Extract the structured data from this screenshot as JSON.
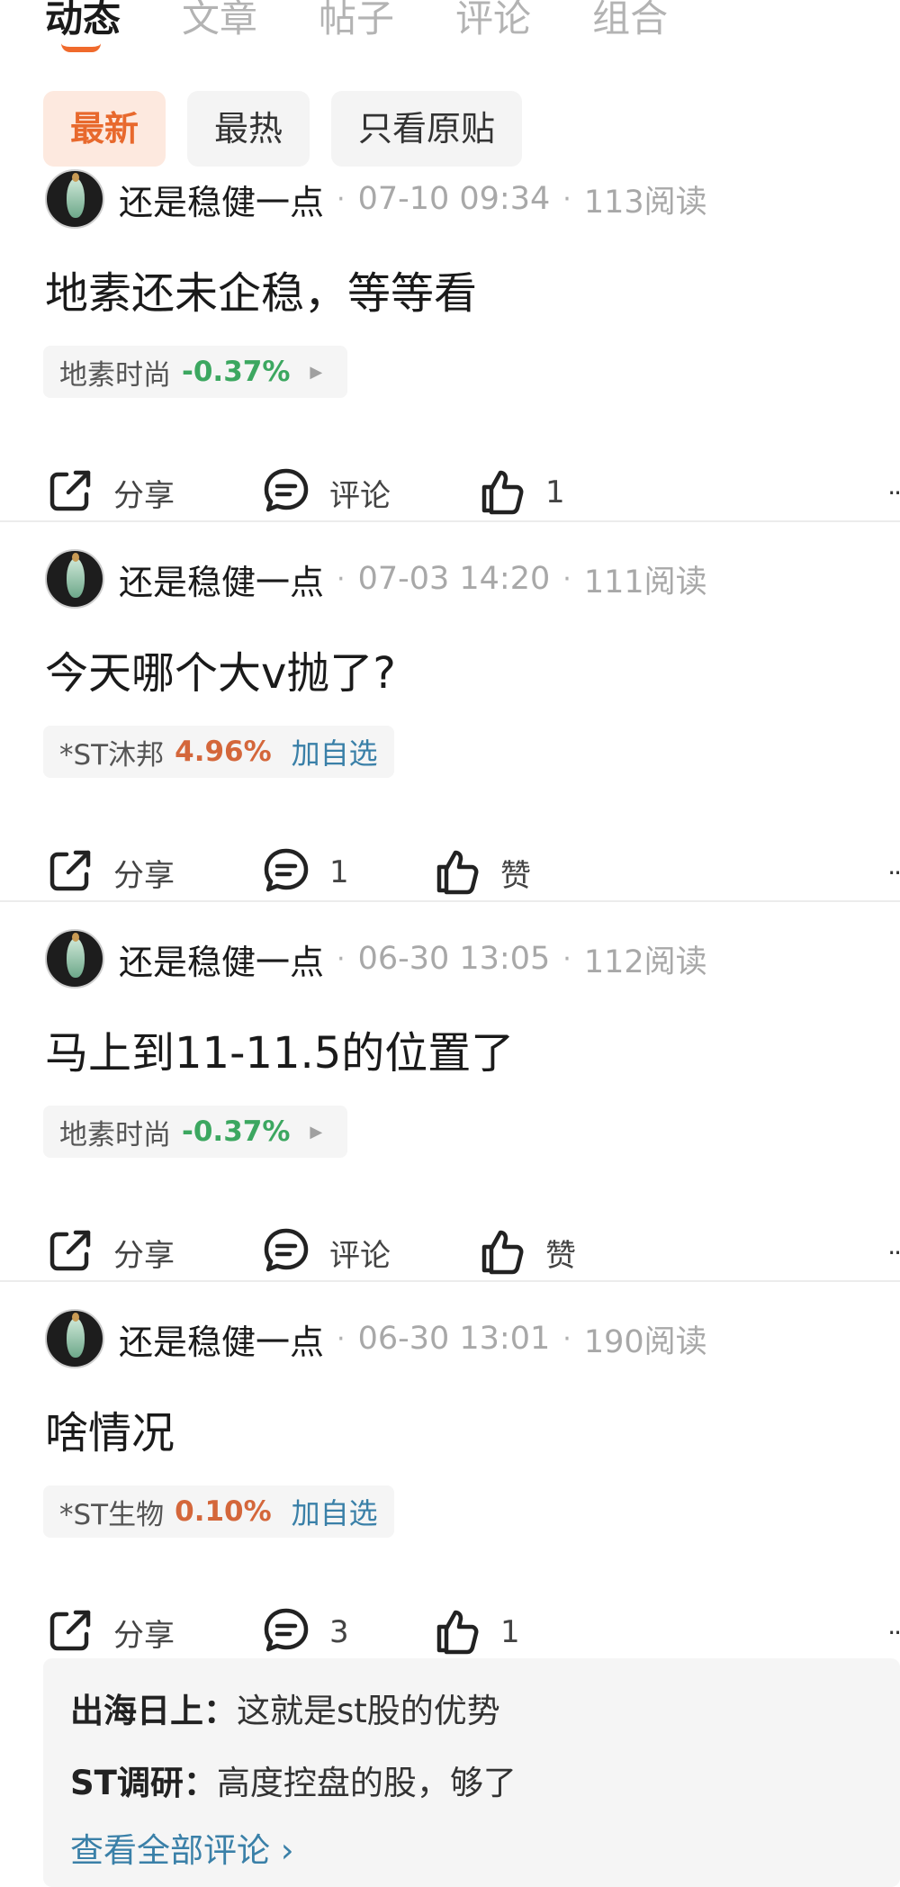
{
  "tabs": [
    "动态",
    "文章",
    "帖子",
    "评论",
    "组合"
  ],
  "filters": [
    "最新",
    "最热",
    "只看原贴"
  ],
  "colors": {
    "accent": "#f06a2c",
    "down": "#3ca760",
    "up": "#d4673b",
    "link": "#3a80a8"
  },
  "posts": [
    {
      "author": "还是稳健一点",
      "time": "07-10 09:34",
      "reads": "113阅读",
      "content": "地素还未企稳，等等看",
      "stock": {
        "name": "地素时尚",
        "change": "-0.37%",
        "arrow": "▶",
        "add": ""
      },
      "share": "分享",
      "comment": "评论",
      "like": "1"
    },
    {
      "author": "还是稳健一点",
      "time": "07-03 14:20",
      "reads": "111阅读",
      "content": "今天哪个大v抛了?",
      "stock": {
        "name": "*ST沐邦",
        "change": "4.96%",
        "arrow": "",
        "add": "加自选"
      },
      "share": "分享",
      "comment": "1",
      "like": "赞"
    },
    {
      "author": "还是稳健一点",
      "time": "06-30 13:05",
      "reads": "112阅读",
      "content": "马上到11-11.5的位置了",
      "stock": {
        "name": "地素时尚",
        "change": "-0.37%",
        "arrow": "▶",
        "add": ""
      },
      "share": "分享",
      "comment": "评论",
      "like": "赞"
    },
    {
      "author": "还是稳健一点",
      "time": "06-30 13:01",
      "reads": "190阅读",
      "content": "啥情况",
      "stock": {
        "name": "*ST生物",
        "change": "0.10%",
        "arrow": "",
        "add": "加自选"
      },
      "share": "分享",
      "comment": "3",
      "like": "1"
    }
  ],
  "comments": [
    {
      "author": "出海日上：",
      "text": "这就是st股的优势"
    },
    {
      "author": "ST调研：",
      "text": "高度控盘的股，够了"
    }
  ],
  "view_all": "查看全部评论 ›",
  "more": "··"
}
